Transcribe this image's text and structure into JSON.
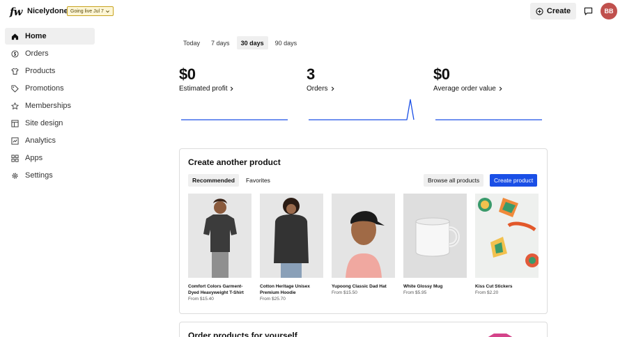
{
  "header": {
    "logo": "fw",
    "shop_name": "Nicelydone",
    "going_live": "Going live Jul 7",
    "create_label": "Create",
    "avatar_initials": "BB",
    "avatar_color": "#c0504d"
  },
  "sidebar": {
    "items": [
      {
        "label": "Home",
        "icon": "home-icon",
        "active": true
      },
      {
        "label": "Orders",
        "icon": "orders-icon"
      },
      {
        "label": "Products",
        "icon": "shirt-icon"
      },
      {
        "label": "Promotions",
        "icon": "tag-icon"
      },
      {
        "label": "Memberships",
        "icon": "star-icon"
      },
      {
        "label": "Site design",
        "icon": "layout-icon"
      },
      {
        "label": "Analytics",
        "icon": "chart-icon"
      },
      {
        "label": "Apps",
        "icon": "grid-icon"
      },
      {
        "label": "Settings",
        "icon": "gear-icon"
      }
    ]
  },
  "period_tabs": [
    {
      "label": "Today"
    },
    {
      "label": "7 days"
    },
    {
      "label": "30 days",
      "active": true
    },
    {
      "label": "90 days"
    }
  ],
  "stats": [
    {
      "value": "$0",
      "label": "Estimated profit"
    },
    {
      "value": "3",
      "label": "Orders"
    },
    {
      "value": "$0",
      "label": "Average order value"
    }
  ],
  "sparkline_color": "#1a4fe6",
  "product_card": {
    "title": "Create another product",
    "tabs": [
      {
        "label": "Recommended",
        "active": true
      },
      {
        "label": "Favorites"
      }
    ],
    "browse_label": "Browse all products",
    "create_label": "Create product",
    "products": [
      {
        "name": "Comfort Colors Garment-Dyed Heavyweight T-Shirt",
        "price": "From $15.40"
      },
      {
        "name": "Cotton Heritage Unisex Premium Hoodie",
        "price": "From $25.70"
      },
      {
        "name": "Yupoong Classic Dad Hat",
        "price": "From $15.50"
      },
      {
        "name": "White Glossy Mug",
        "price": "From $5.95"
      },
      {
        "name": "Kiss Cut Stickers",
        "price": "From $2.20"
      }
    ]
  },
  "order_card": {
    "title": "Order products for yourself"
  },
  "accent_color": "#1a4fe6"
}
